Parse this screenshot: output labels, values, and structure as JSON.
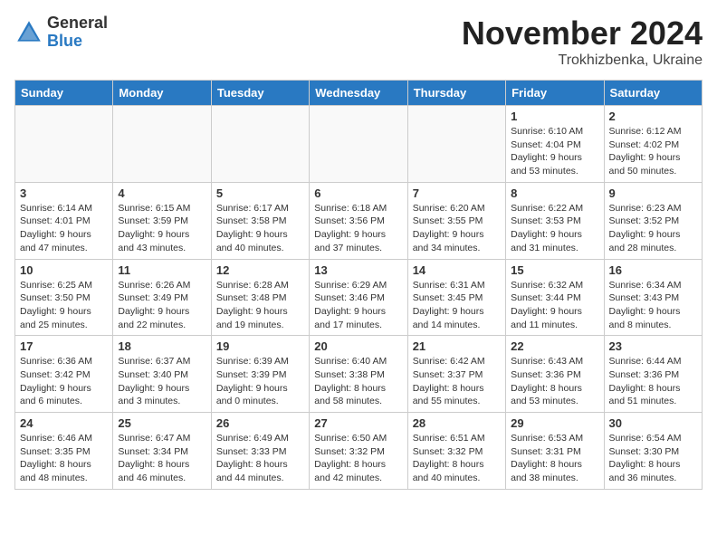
{
  "logo": {
    "general": "General",
    "blue": "Blue"
  },
  "title": "November 2024",
  "subtitle": "Trokhizbenka, Ukraine",
  "days_header": [
    "Sunday",
    "Monday",
    "Tuesday",
    "Wednesday",
    "Thursday",
    "Friday",
    "Saturday"
  ],
  "weeks": [
    [
      {
        "day": "",
        "info": ""
      },
      {
        "day": "",
        "info": ""
      },
      {
        "day": "",
        "info": ""
      },
      {
        "day": "",
        "info": ""
      },
      {
        "day": "",
        "info": ""
      },
      {
        "day": "1",
        "info": "Sunrise: 6:10 AM\nSunset: 4:04 PM\nDaylight: 9 hours\nand 53 minutes."
      },
      {
        "day": "2",
        "info": "Sunrise: 6:12 AM\nSunset: 4:02 PM\nDaylight: 9 hours\nand 50 minutes."
      }
    ],
    [
      {
        "day": "3",
        "info": "Sunrise: 6:14 AM\nSunset: 4:01 PM\nDaylight: 9 hours\nand 47 minutes."
      },
      {
        "day": "4",
        "info": "Sunrise: 6:15 AM\nSunset: 3:59 PM\nDaylight: 9 hours\nand 43 minutes."
      },
      {
        "day": "5",
        "info": "Sunrise: 6:17 AM\nSunset: 3:58 PM\nDaylight: 9 hours\nand 40 minutes."
      },
      {
        "day": "6",
        "info": "Sunrise: 6:18 AM\nSunset: 3:56 PM\nDaylight: 9 hours\nand 37 minutes."
      },
      {
        "day": "7",
        "info": "Sunrise: 6:20 AM\nSunset: 3:55 PM\nDaylight: 9 hours\nand 34 minutes."
      },
      {
        "day": "8",
        "info": "Sunrise: 6:22 AM\nSunset: 3:53 PM\nDaylight: 9 hours\nand 31 minutes."
      },
      {
        "day": "9",
        "info": "Sunrise: 6:23 AM\nSunset: 3:52 PM\nDaylight: 9 hours\nand 28 minutes."
      }
    ],
    [
      {
        "day": "10",
        "info": "Sunrise: 6:25 AM\nSunset: 3:50 PM\nDaylight: 9 hours\nand 25 minutes."
      },
      {
        "day": "11",
        "info": "Sunrise: 6:26 AM\nSunset: 3:49 PM\nDaylight: 9 hours\nand 22 minutes."
      },
      {
        "day": "12",
        "info": "Sunrise: 6:28 AM\nSunset: 3:48 PM\nDaylight: 9 hours\nand 19 minutes."
      },
      {
        "day": "13",
        "info": "Sunrise: 6:29 AM\nSunset: 3:46 PM\nDaylight: 9 hours\nand 17 minutes."
      },
      {
        "day": "14",
        "info": "Sunrise: 6:31 AM\nSunset: 3:45 PM\nDaylight: 9 hours\nand 14 minutes."
      },
      {
        "day": "15",
        "info": "Sunrise: 6:32 AM\nSunset: 3:44 PM\nDaylight: 9 hours\nand 11 minutes."
      },
      {
        "day": "16",
        "info": "Sunrise: 6:34 AM\nSunset: 3:43 PM\nDaylight: 9 hours\nand 8 minutes."
      }
    ],
    [
      {
        "day": "17",
        "info": "Sunrise: 6:36 AM\nSunset: 3:42 PM\nDaylight: 9 hours\nand 6 minutes."
      },
      {
        "day": "18",
        "info": "Sunrise: 6:37 AM\nSunset: 3:40 PM\nDaylight: 9 hours\nand 3 minutes."
      },
      {
        "day": "19",
        "info": "Sunrise: 6:39 AM\nSunset: 3:39 PM\nDaylight: 9 hours\nand 0 minutes."
      },
      {
        "day": "20",
        "info": "Sunrise: 6:40 AM\nSunset: 3:38 PM\nDaylight: 8 hours\nand 58 minutes."
      },
      {
        "day": "21",
        "info": "Sunrise: 6:42 AM\nSunset: 3:37 PM\nDaylight: 8 hours\nand 55 minutes."
      },
      {
        "day": "22",
        "info": "Sunrise: 6:43 AM\nSunset: 3:36 PM\nDaylight: 8 hours\nand 53 minutes."
      },
      {
        "day": "23",
        "info": "Sunrise: 6:44 AM\nSunset: 3:36 PM\nDaylight: 8 hours\nand 51 minutes."
      }
    ],
    [
      {
        "day": "24",
        "info": "Sunrise: 6:46 AM\nSunset: 3:35 PM\nDaylight: 8 hours\nand 48 minutes."
      },
      {
        "day": "25",
        "info": "Sunrise: 6:47 AM\nSunset: 3:34 PM\nDaylight: 8 hours\nand 46 minutes."
      },
      {
        "day": "26",
        "info": "Sunrise: 6:49 AM\nSunset: 3:33 PM\nDaylight: 8 hours\nand 44 minutes."
      },
      {
        "day": "27",
        "info": "Sunrise: 6:50 AM\nSunset: 3:32 PM\nDaylight: 8 hours\nand 42 minutes."
      },
      {
        "day": "28",
        "info": "Sunrise: 6:51 AM\nSunset: 3:32 PM\nDaylight: 8 hours\nand 40 minutes."
      },
      {
        "day": "29",
        "info": "Sunrise: 6:53 AM\nSunset: 3:31 PM\nDaylight: 8 hours\nand 38 minutes."
      },
      {
        "day": "30",
        "info": "Sunrise: 6:54 AM\nSunset: 3:30 PM\nDaylight: 8 hours\nand 36 minutes."
      }
    ]
  ]
}
